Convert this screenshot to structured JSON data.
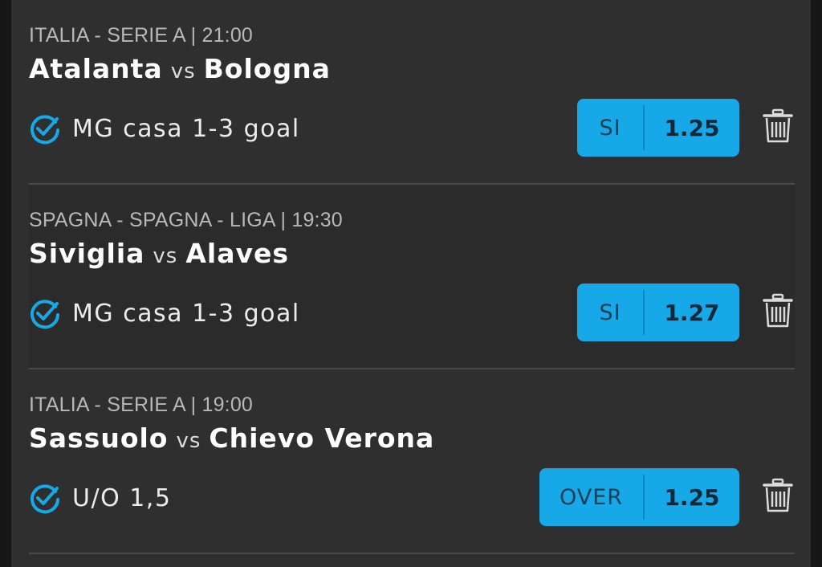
{
  "bets": [
    {
      "league": "ITALIA - SERIE A | 21:00",
      "home": "Atalanta",
      "vs": "vs",
      "away": "Bologna",
      "market": "MG casa 1-3 goal",
      "pick": "SI",
      "odds": "1.25"
    },
    {
      "league": "SPAGNA - SPAGNA - LIGA | 19:30",
      "home": "Siviglia",
      "vs": "vs",
      "away": "Alaves",
      "market": "MG casa 1-3 goal",
      "pick": "SI",
      "odds": "1.27"
    },
    {
      "league": "ITALIA - SERIE A | 19:00",
      "home": "Sassuolo",
      "vs": "vs",
      "away": "Chievo Verona",
      "market": "U/O 1,5",
      "pick": "OVER",
      "odds": "1.25"
    }
  ],
  "icons": {
    "selection": "check-circle-icon",
    "remove": "trash-icon"
  },
  "colors": {
    "accent": "#16a8e7",
    "background": "#2f2f2f"
  }
}
